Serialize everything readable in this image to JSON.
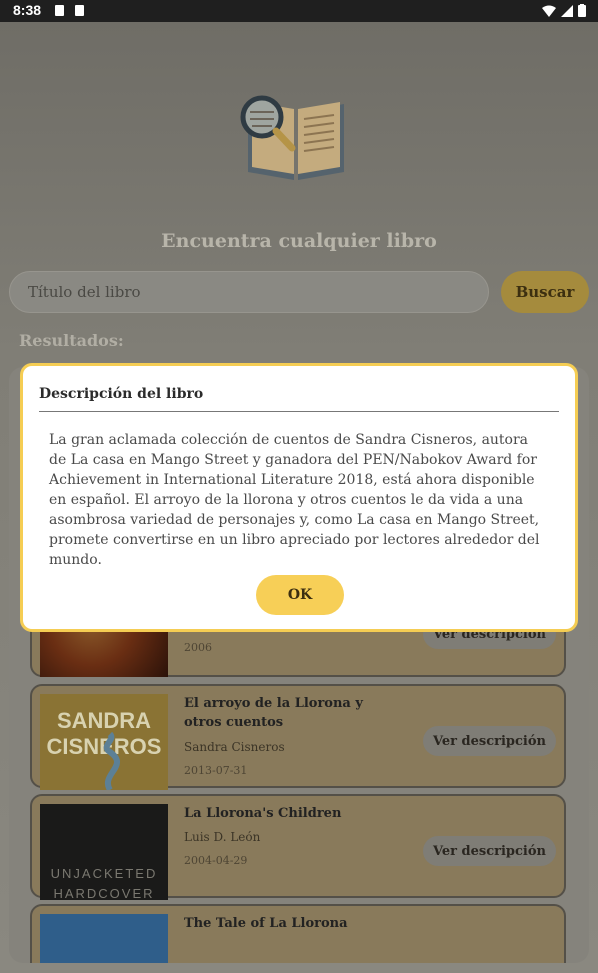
{
  "status_bar": {
    "time": "8:38"
  },
  "header": {
    "title": "Encuentra cualquier libro"
  },
  "search": {
    "placeholder": "Título del libro",
    "button_label": "Buscar"
  },
  "results": {
    "label": "Resultados:",
    "items": [
      {
        "title": "",
        "author": "",
        "date": "2006",
        "button": "Ver descripción"
      },
      {
        "title": "El arroyo de la Llorona y otros cuentos",
        "author": "Sandra Cisneros",
        "date": "2013-07-31",
        "button": "Ver descripción",
        "cover_text": [
          "SANDRA",
          "CISNEROS"
        ]
      },
      {
        "title": "La Llorona's Children",
        "author": "Luis D. León",
        "date": "2004-04-29",
        "button": "Ver descripción",
        "cover_text": [
          "UNJACKETED",
          "HARDCOVER"
        ]
      },
      {
        "title": "The Tale of La Llorona",
        "author": "",
        "date": "",
        "button": ""
      }
    ]
  },
  "dialog": {
    "title": "Descripción del libro",
    "body": "La gran aclamada colección de cuentos de Sandra Cisneros, autora de La casa en Mango Street y ganadora del PEN/Nabokov Award for Achievement in International Literature 2018, está ahora disponible en español. El arroyo de la llorona y otros cuentos le da vida a una asombrosa variedad de personajes y, como La casa en Mango Street, promete convertirse en un libro apreciado por lectores alrededor del mundo.",
    "ok_label": "OK"
  },
  "colors": {
    "accent": "#f7cf57",
    "scrim": "#7f7d76"
  }
}
